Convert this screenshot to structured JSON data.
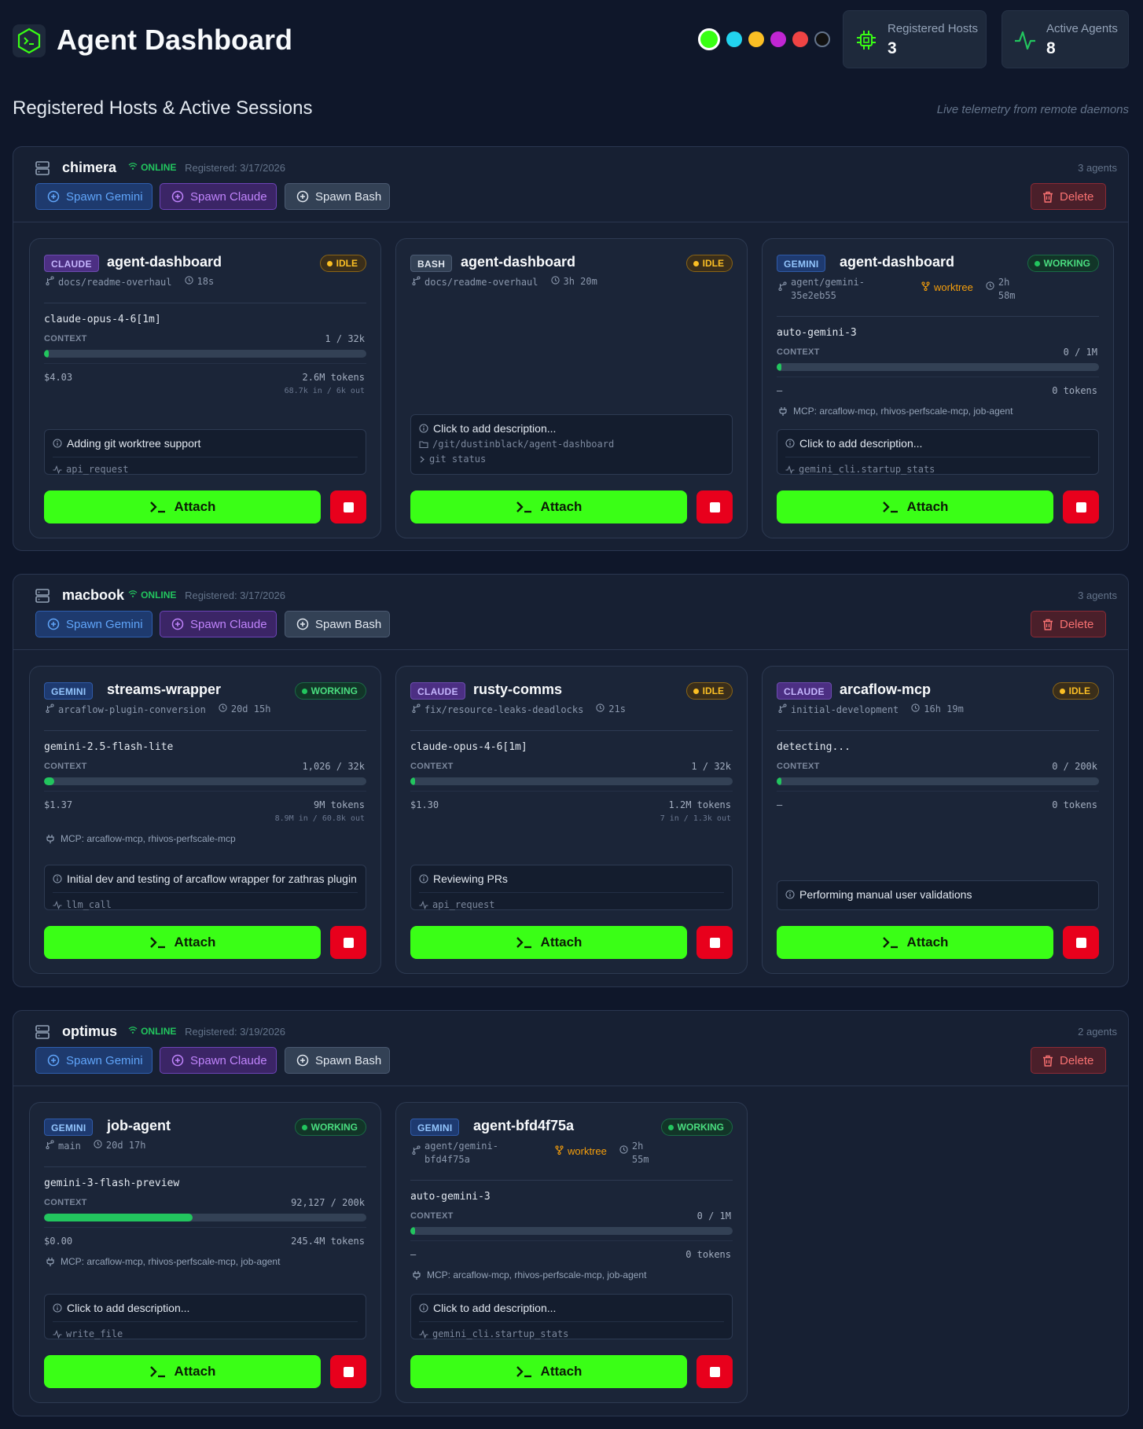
{
  "header": {
    "title": "Agent Dashboard",
    "theme_colors": [
      "#39ff14",
      "#22d3ee",
      "#fbbf24",
      "#c026d3",
      "#ef4444",
      "#111111"
    ],
    "stats": [
      {
        "label": "Registered Hosts",
        "value": "3",
        "icon": "cpu-icon"
      },
      {
        "label": "Active Agents",
        "value": "8",
        "icon": "activity-icon"
      }
    ]
  },
  "section": {
    "title": "Registered Hosts & Active Sessions",
    "subtitle": "Live telemetry from remote daemons"
  },
  "buttons": {
    "spawn_gemini": "Spawn Gemini",
    "spawn_claude": "Spawn Claude",
    "spawn_bash": "Spawn Bash",
    "delete": "Delete",
    "attach": "Attach",
    "context_label": "CONTEXT"
  },
  "hosts": [
    {
      "name": "chimera",
      "status": "ONLINE",
      "registered": "Registered: 3/17/2026",
      "agent_count": "3 agents",
      "agents": [
        {
          "type": "CLAUDE",
          "name": "agent-dashboard",
          "status": "IDLE",
          "branch": "docs/readme-overhaul",
          "time": "18s",
          "model": "claude-opus-4-6[1m]",
          "context": "1 / 32k",
          "context_fill": 0.0003,
          "cost": "$4.03",
          "tokens": "2.6M tokens",
          "io": "68.7k in / 6k out",
          "description": "Adding git worktree support",
          "activity": "api_request"
        },
        {
          "type": "BASH",
          "name": "agent-dashboard",
          "status": "IDLE",
          "branch": "docs/readme-overhaul",
          "time": "3h 20m",
          "description": "Click to add description...",
          "path": "/git/dustinblack/agent-dashboard",
          "command": "git status"
        },
        {
          "type": "GEMINI",
          "name": "agent-dashboard",
          "status": "WORKING",
          "branch_l1": "agent/gemini-",
          "branch_l2": "35e2eb55",
          "worktree": "worktree",
          "time_l1": "2h",
          "time_l2": "58m",
          "model": "auto-gemini-3",
          "context": "0 / 1M",
          "context_fill": 0,
          "cost": "—",
          "tokens": "0 tokens",
          "mcp": "MCP: arcaflow-mcp, rhivos-perfscale-mcp, job-agent",
          "description": "Click to add description...",
          "activity": "gemini_cli.startup_stats"
        }
      ]
    },
    {
      "name": "macbook",
      "status": "ONLINE",
      "registered": "Registered: 3/17/2026",
      "agent_count": "3 agents",
      "agents": [
        {
          "type": "GEMINI",
          "name": "streams-wrapper",
          "status": "WORKING",
          "branch": "arcaflow-plugin-conversion",
          "time": "20d 15h",
          "model": "gemini-2.5-flash-lite",
          "context": "1,026 / 32k",
          "context_fill": 0.031,
          "cost": "$1.37",
          "tokens": "9M tokens",
          "io": "8.9M in / 60.8k out",
          "mcp": "MCP: arcaflow-mcp, rhivos-perfscale-mcp",
          "description": "Initial dev and testing of arcaflow wrapper for zathras plugin",
          "activity": "llm_call"
        },
        {
          "type": "CLAUDE",
          "name": "rusty-comms",
          "status": "IDLE",
          "branch": "fix/resource-leaks-deadlocks",
          "time": "21s",
          "model": "claude-opus-4-6[1m]",
          "context": "1 / 32k",
          "context_fill": 0.0003,
          "cost": "$1.30",
          "tokens": "1.2M tokens",
          "io": "7 in / 1.3k out",
          "description": "Reviewing PRs",
          "activity": "api_request"
        },
        {
          "type": "CLAUDE",
          "name": "arcaflow-mcp",
          "status": "IDLE",
          "branch": "initial-development",
          "time": "16h 19m",
          "model": "detecting...",
          "context": "0 / 200k",
          "context_fill": 0,
          "cost": "—",
          "tokens": "0 tokens",
          "description": "Performing manual user validations"
        }
      ]
    },
    {
      "name": "optimus",
      "status": "ONLINE",
      "registered": "Registered: 3/19/2026",
      "agent_count": "2 agents",
      "agents": [
        {
          "type": "GEMINI",
          "name": "job-agent",
          "status": "WORKING",
          "branch": "main",
          "time": "20d 17h",
          "model": "gemini-3-flash-preview",
          "context": "92,127 / 200k",
          "context_fill": 0.46,
          "cost": "$0.00",
          "tokens": "245.4M tokens",
          "mcp": "MCP: arcaflow-mcp, rhivos-perfscale-mcp, job-agent",
          "description": "Click to add description...",
          "activity": "write_file"
        },
        {
          "type": "GEMINI",
          "name": "agent-bfd4f75a",
          "status": "WORKING",
          "branch_l1": "agent/gemini-",
          "branch_l2": "bfd4f75a",
          "worktree": "worktree",
          "time_l1": "2h",
          "time_l2": "55m",
          "model": "auto-gemini-3",
          "context": "0 / 1M",
          "context_fill": 0,
          "cost": "—",
          "tokens": "0 tokens",
          "mcp": "MCP: arcaflow-mcp, rhivos-perfscale-mcp, job-agent",
          "description": "Click to add description...",
          "activity": "gemini_cli.startup_stats"
        }
      ]
    }
  ]
}
